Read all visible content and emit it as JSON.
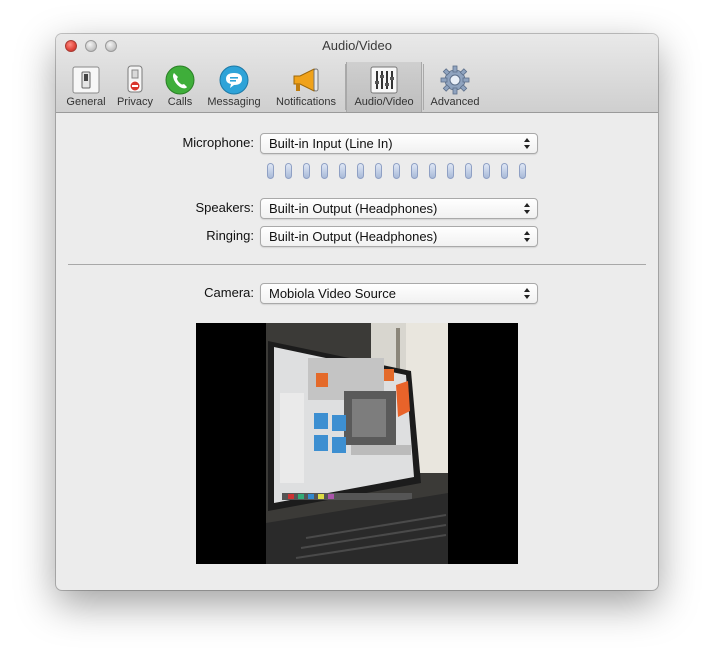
{
  "window": {
    "title": "Audio/Video"
  },
  "toolbar": {
    "items": [
      {
        "label": "General",
        "icon": "general-switch-icon"
      },
      {
        "label": "Privacy",
        "icon": "privacy-icon"
      },
      {
        "label": "Calls",
        "icon": "phone-icon"
      },
      {
        "label": "Messaging",
        "icon": "chat-bubble-icon"
      },
      {
        "label": "Notifications",
        "icon": "megaphone-icon"
      },
      {
        "label": "Audio/Video",
        "icon": "mixer-sliders-icon",
        "selected": true
      },
      {
        "label": "Advanced",
        "icon": "gear-icon"
      }
    ]
  },
  "audio": {
    "microphone_label": "Microphone:",
    "microphone_value": "Built-in Input (Line In)",
    "level_segments": 15,
    "speakers_label": "Speakers:",
    "speakers_value": "Built-in Output (Headphones)",
    "ringing_label": "Ringing:",
    "ringing_value": "Built-in Output (Headphones)"
  },
  "video": {
    "camera_label": "Camera:",
    "camera_value": "Mobiola Video Source"
  },
  "colors": {
    "accent_selected_tab": "#bdbdbd",
    "meter_segment": "#a9bad8",
    "call_green": "#3fae3a",
    "messaging_blue": "#2ea3d8",
    "notification_orange": "#f0a21a"
  }
}
